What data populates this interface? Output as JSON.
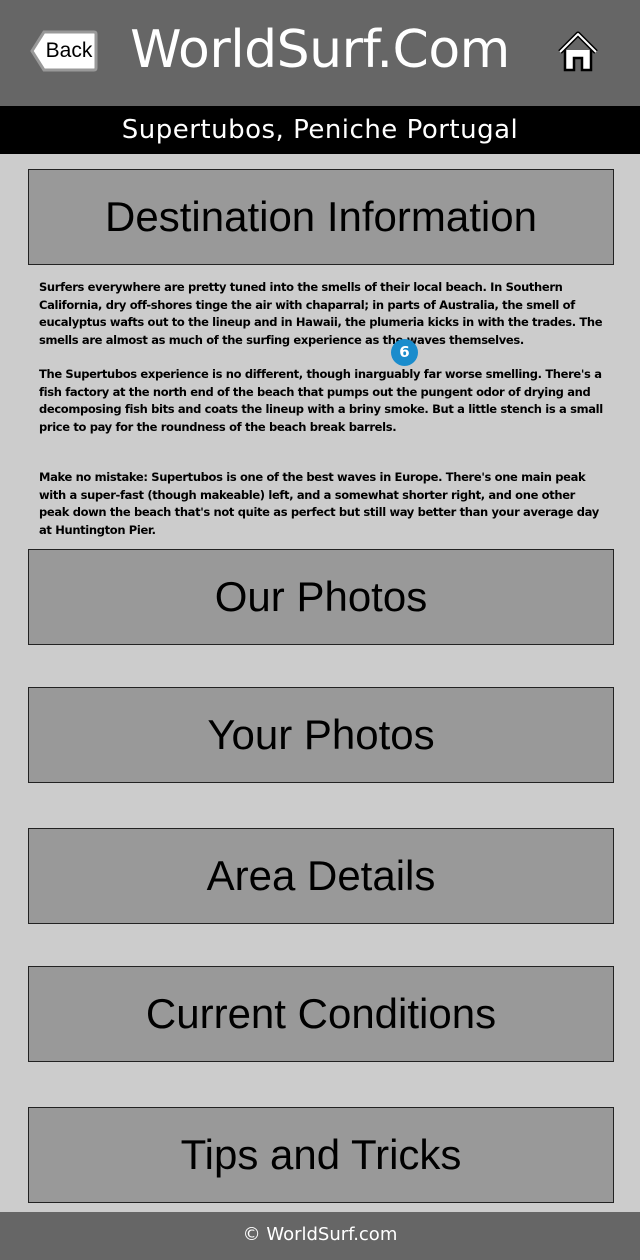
{
  "header": {
    "back_label": "Back",
    "title": "WorldSurf.Com",
    "home_icon": "home-icon"
  },
  "subtitle": "Supertubos, Peniche Portugal",
  "sections": {
    "destination": "Destination Information",
    "our_photos": "Our Photos",
    "your_photos": "Your Photos",
    "area_details": "Area Details",
    "current_conditions": "Current Conditions",
    "tips": "Tips and Tricks"
  },
  "description": {
    "p1": "Surfers everywhere are pretty tuned into the smells of their local beach. In Southern California, dry off-shores tinge the air with chaparral; in parts of Australia,  the smell of eucalyptus wafts out to the lineup and in Hawaii, the plumeria kicks in with the trades. The smells are almost as much of the surfing experience as the waves themselves.",
    "p2": "The Supertubos experience is no different, though inarguably far worse smelling. There's a fish factory at the north end of the beach that pumps out the pungent odor of drying and decomposing fish bits and coats the lineup with a briny smoke. But a little stench is a small price to pay for the roundness of the beach break barrels.",
    "p3": "Make no mistake: Supertubos is one of the best waves in Europe. There's one main peak with a super-fast (though makeable) left, and a somewhat shorter right, and one other peak down the beach that's not quite as perfect but still way better than your average day at Huntington Pier."
  },
  "badge": "6",
  "footer": "© WorldSurf.com",
  "colors": {
    "header_bg": "#666666",
    "page_bg": "#cccccc",
    "button_bg": "#999999",
    "subtitle_bg": "#000000",
    "badge_bg": "#1a8ccc"
  }
}
